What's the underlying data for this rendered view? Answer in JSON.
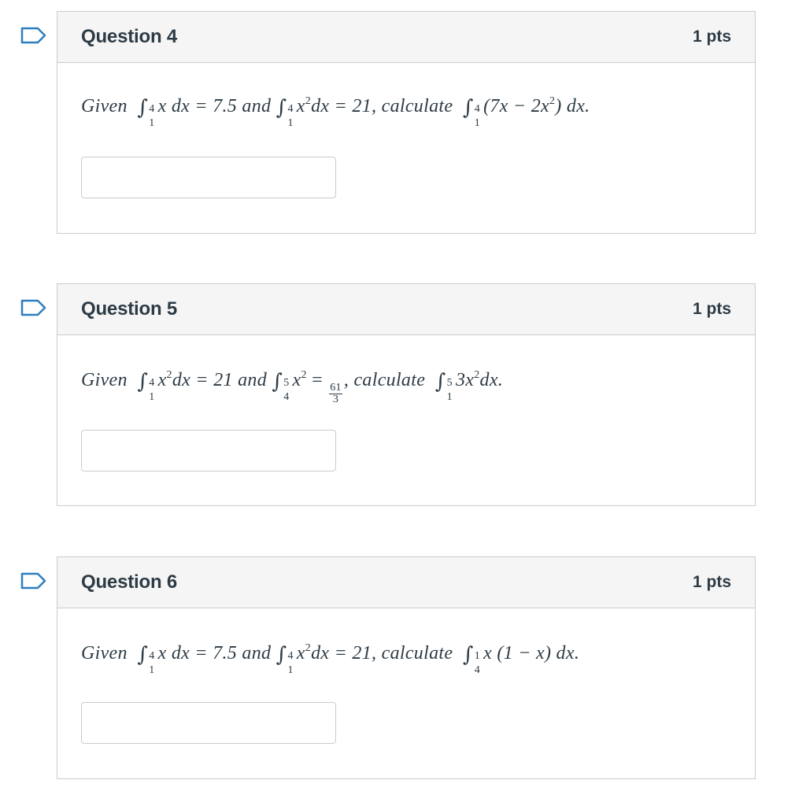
{
  "accent_color": "#2d7ebf",
  "questions": [
    {
      "title": "Question 4",
      "points": "1 pts",
      "flag_icon": "bookmark-flag-icon",
      "text": {
        "given": "Given",
        "int1_upper": "4",
        "int1_lower": "1",
        "int1_expr": "x dx = 7.5",
        "and": "and",
        "int2_upper": "4",
        "int2_lower": "1",
        "int2_base": "x",
        "int2_power": "2",
        "int2_rest": "dx = 21,",
        "calculate": "calculate",
        "int3_upper": "4",
        "int3_lower": "1",
        "int3_expr_a": "(7x − 2x",
        "int3_power": "2",
        "int3_expr_b": ") dx."
      },
      "answer_value": ""
    },
    {
      "title": "Question 5",
      "points": "1 pts",
      "flag_icon": "bookmark-flag-icon",
      "text": {
        "given": "Given",
        "int1_upper": "4",
        "int1_lower": "1",
        "int1_base": "x",
        "int1_power": "2",
        "int1_rest": "dx = 21",
        "and": "and",
        "int2_upper": "5",
        "int2_lower": "4",
        "int2_base": "x",
        "int2_power": "2",
        "int2_eq": "=",
        "frac_num": "61",
        "frac_den": "3",
        "comma": ",",
        "calculate": "calculate",
        "int3_upper": "5",
        "int3_lower": "1",
        "int3_base": "3x",
        "int3_power": "2",
        "int3_rest": "dx."
      },
      "answer_value": ""
    },
    {
      "title": "Question 6",
      "points": "1 pts",
      "flag_icon": "bookmark-flag-icon",
      "text": {
        "given": "Given",
        "int1_upper": "4",
        "int1_lower": "1",
        "int1_expr": "x dx = 7.5",
        "and": "and",
        "int2_upper": "4",
        "int2_lower": "1",
        "int2_base": "x",
        "int2_power": "2",
        "int2_rest": "dx = 21,",
        "calculate": "calculate",
        "int3_upper": "1",
        "int3_lower": "4",
        "int3_expr": "x (1 − x) dx."
      },
      "answer_value": ""
    }
  ]
}
